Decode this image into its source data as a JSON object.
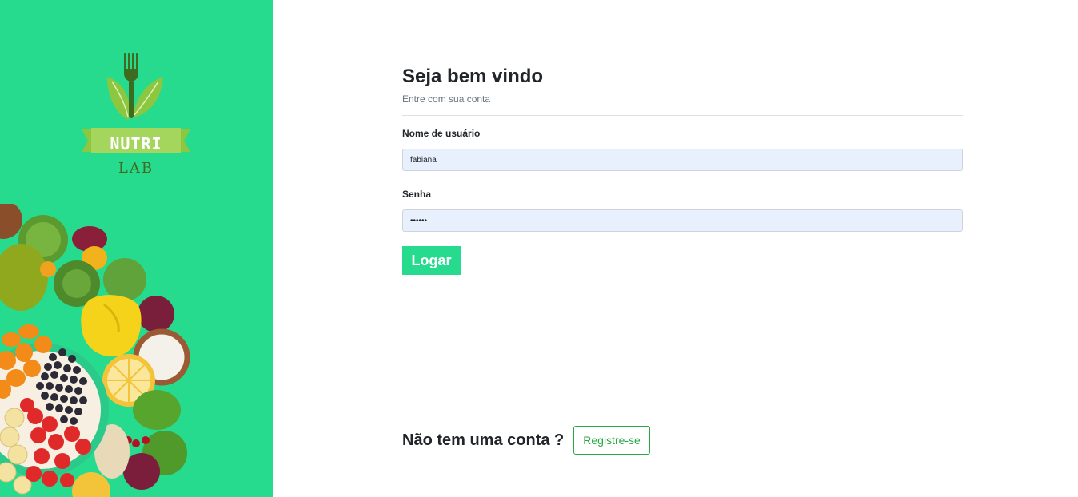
{
  "brand": {
    "logo_word": "NUTRI",
    "logo_subword": "LAB",
    "colors": {
      "accent": "#26db8d",
      "logo_leaf": "#8dc63f",
      "logo_dark": "#3d6b1f",
      "register_outline": "#28a745"
    },
    "icons": [
      "fork-icon",
      "leaf-icon"
    ]
  },
  "login": {
    "title": "Seja bem vindo",
    "subtitle": "Entre com sua conta",
    "username_label": "Nome de usuário",
    "username_value": "fabiana",
    "password_label": "Senha",
    "password_value": "123456",
    "submit_label": "Logar"
  },
  "register": {
    "prompt": "Não tem uma conta ?",
    "button_label": "Registre-se"
  }
}
